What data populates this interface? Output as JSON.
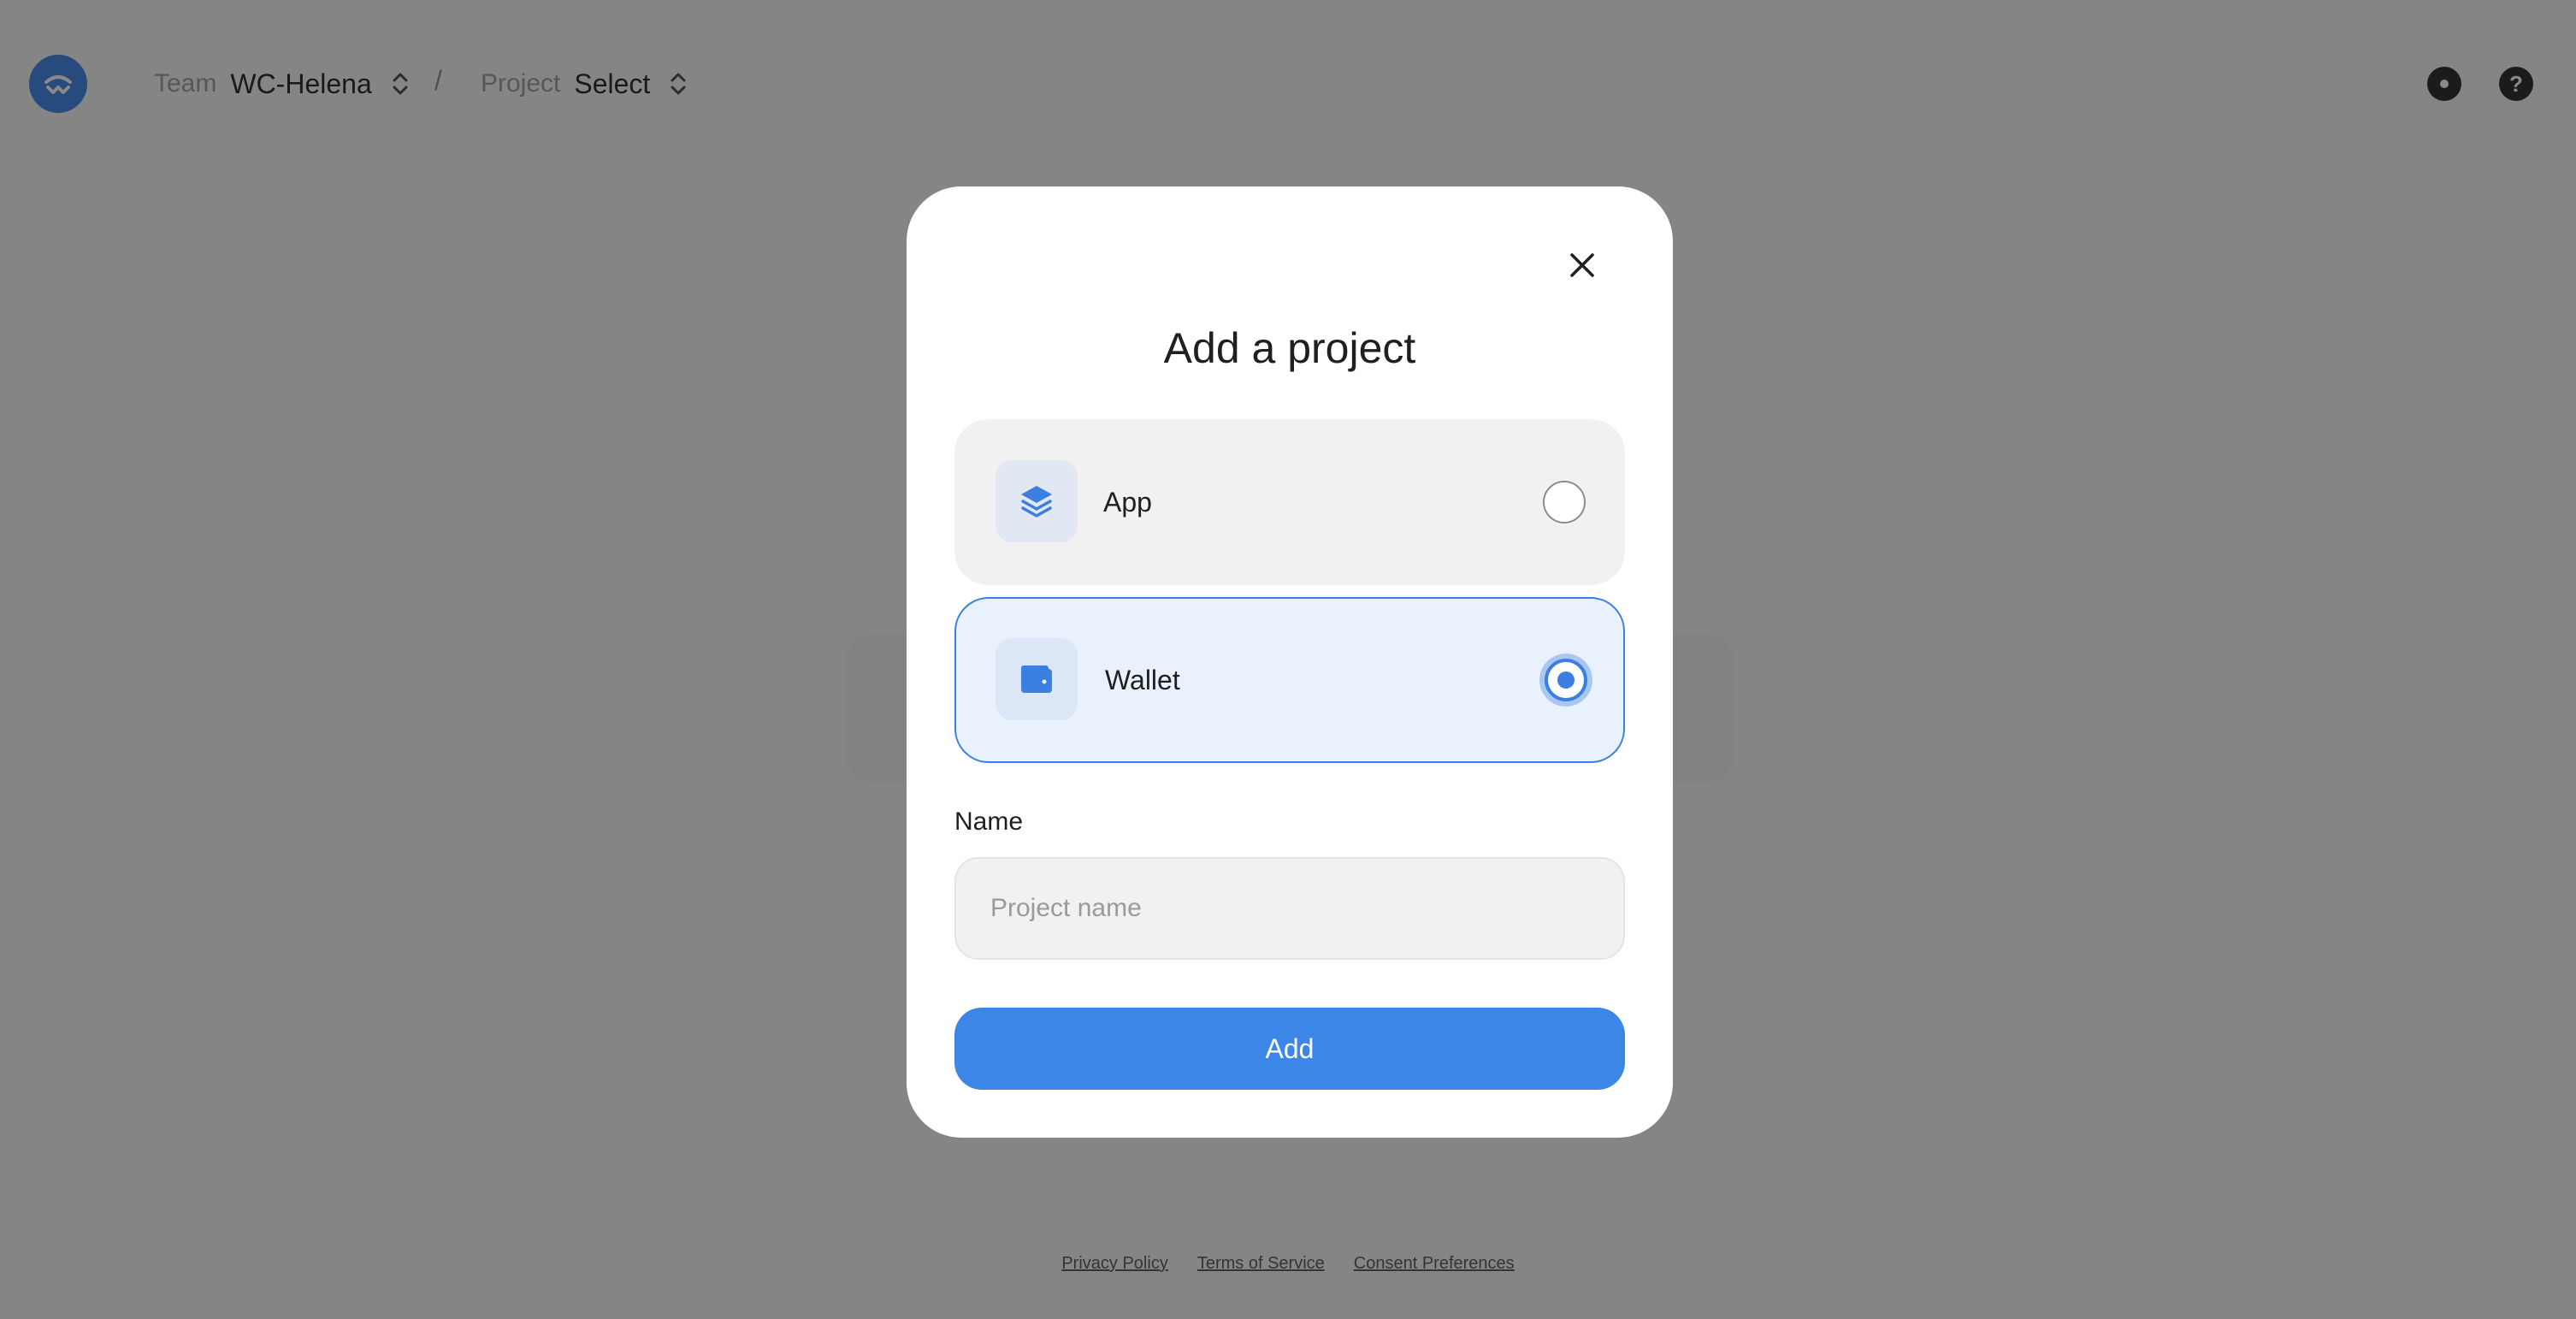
{
  "header": {
    "team_label": "Team",
    "team_value": "WC-Helena",
    "separator": "/",
    "project_label": "Project",
    "project_value": "Select",
    "icons": [
      "walletconnect-logo-icon",
      "settings-icon",
      "help-icon"
    ]
  },
  "footer": {
    "links": [
      "Privacy Policy",
      "Terms of Service",
      "Consent Preferences"
    ]
  },
  "modal": {
    "title": "Add a project",
    "options": [
      {
        "label": "App",
        "icon": "layers-icon",
        "selected": false
      },
      {
        "label": "Wallet",
        "icon": "wallet-icon",
        "selected": true
      }
    ],
    "name_label": "Name",
    "name_value": "",
    "name_placeholder": "Project name",
    "submit_label": "Add"
  },
  "colors": {
    "accent": "#3b86e6",
    "selected_bg": "#e9f1fc",
    "overlay": "rgba(20,20,20,0.5)"
  }
}
